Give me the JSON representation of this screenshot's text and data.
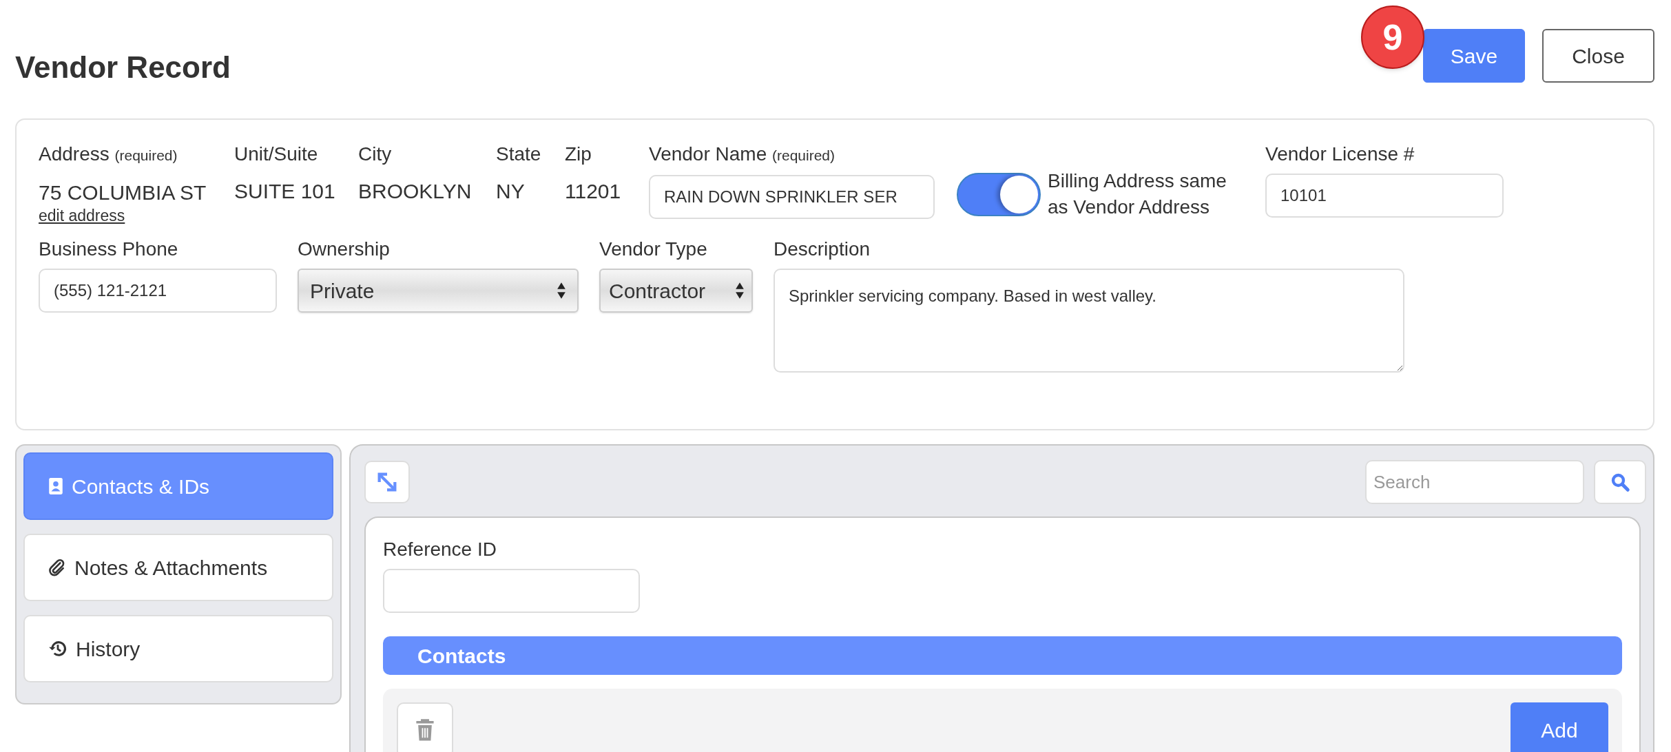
{
  "page": {
    "title": "Vendor Record"
  },
  "header": {
    "badge": "9",
    "buttons": [
      {
        "label": "Save",
        "kind": "primary"
      },
      {
        "label": "Close",
        "kind": "secondary"
      }
    ]
  },
  "address": [
    {
      "label": "Address",
      "note": "(required)",
      "value": "75 COLUMBIA ST",
      "link": "edit address"
    },
    {
      "label": "Unit/Suite",
      "value": "SUITE 101"
    },
    {
      "label": "City",
      "value": "BROOKLYN"
    },
    {
      "label": "State",
      "value": "NY"
    },
    {
      "label": "Zip",
      "value": "11201"
    }
  ],
  "vendor_name": {
    "label": "Vendor Name",
    "note": "(required)",
    "value": "RAIN DOWN SPRINKLER SER"
  },
  "billing_toggle": {
    "label": "Billing Address same as Vendor Address",
    "on": true
  },
  "vendor_license": {
    "label": "Vendor License #",
    "value": "10101"
  },
  "business_phone": {
    "label": "Business Phone",
    "value": "(555) 121-2121"
  },
  "ownership": {
    "label": "Ownership",
    "value": "Private"
  },
  "vendor_type": {
    "label": "Vendor Type",
    "value": "Contractor"
  },
  "description": {
    "label": "Description",
    "value": "Sprinkler servicing company. Based in west valley."
  },
  "sidebar": {
    "tabs": [
      {
        "label": "Contacts & IDs",
        "selected": true
      },
      {
        "label": "Notes & Attachments",
        "selected": false
      },
      {
        "label": "History",
        "selected": false
      }
    ]
  },
  "panel": {
    "search": {
      "placeholder": "Search"
    },
    "reference_id": {
      "label": "Reference ID"
    },
    "section": "Contacts",
    "add_button": "Add"
  }
}
